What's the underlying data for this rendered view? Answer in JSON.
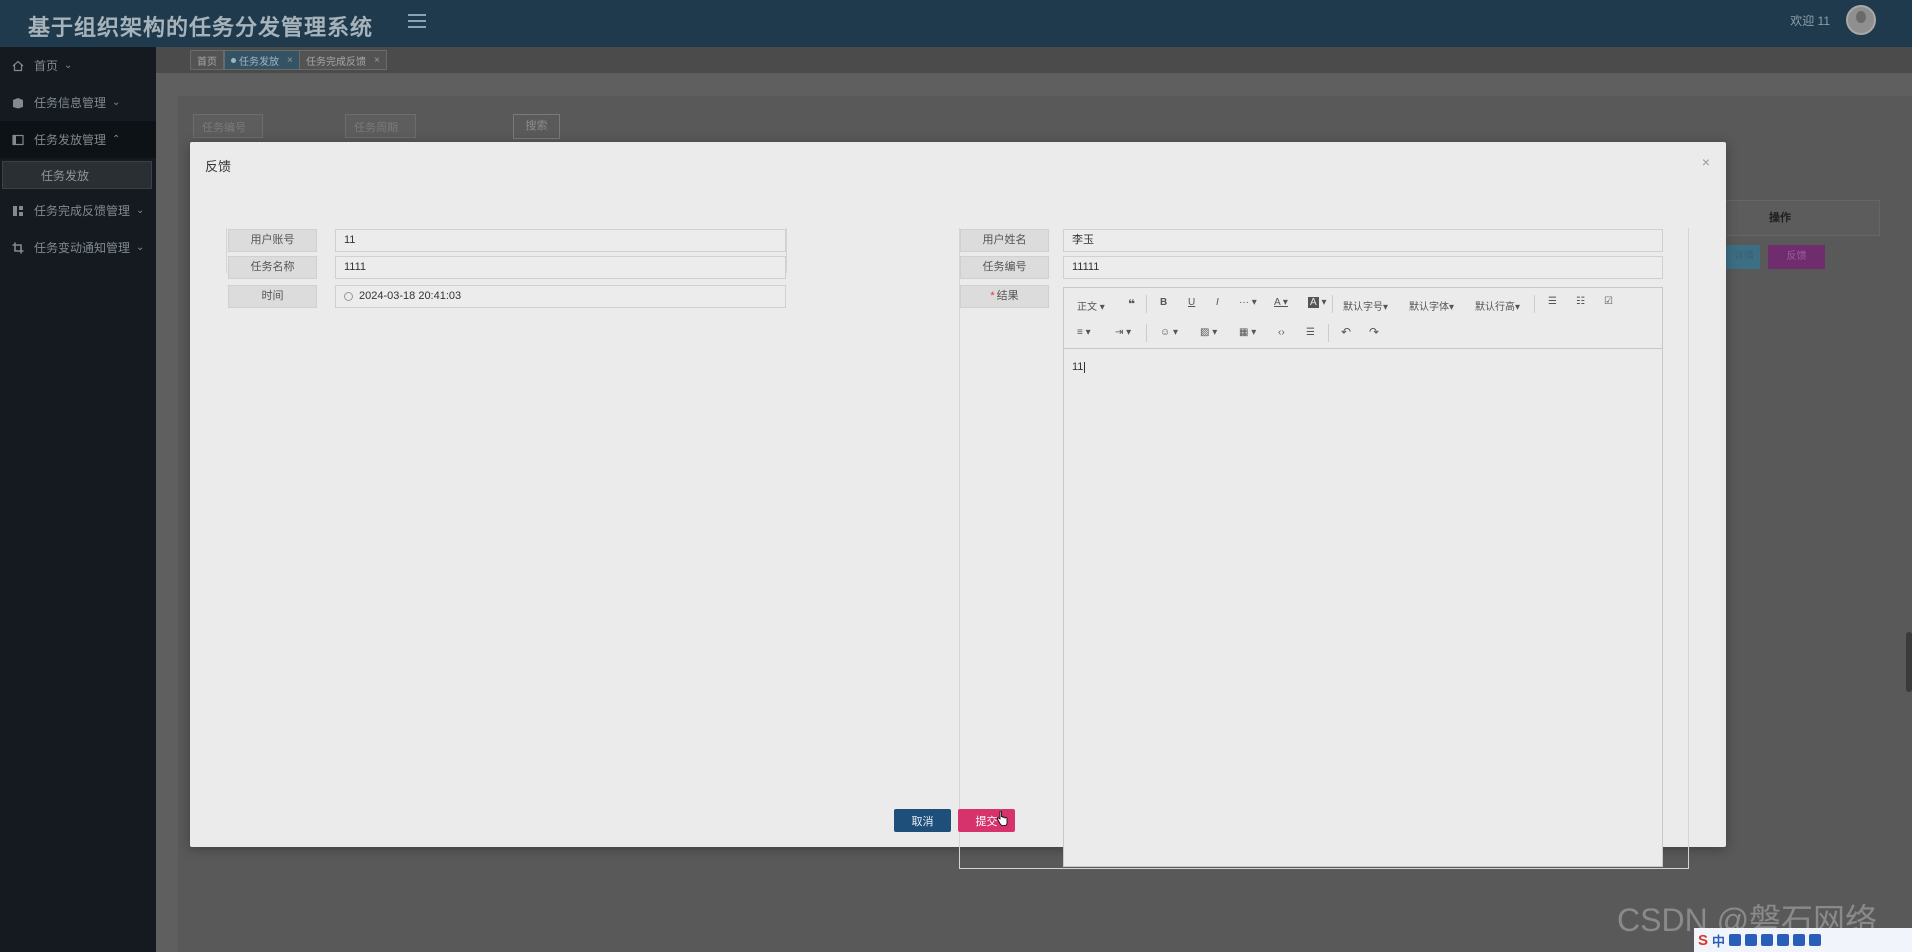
{
  "header": {
    "app_title": "基于组织架构的任务分发管理系统",
    "welcome": "欢迎 11"
  },
  "sidebar": {
    "items": [
      {
        "label": "首页",
        "icon": "home-icon"
      },
      {
        "label": "任务信息管理",
        "icon": "book-icon"
      },
      {
        "label": "任务发放管理",
        "icon": "panel-icon"
      },
      {
        "label": "任务完成反馈管理",
        "icon": "grid-icon"
      },
      {
        "label": "任务变动通知管理",
        "icon": "crop-icon"
      }
    ],
    "sub_item": "任务发放"
  },
  "tabs": [
    {
      "label": "首页"
    },
    {
      "label": "任务发放"
    },
    {
      "label": "任务完成反馈"
    }
  ],
  "background": {
    "task_no_placeholder": "任务编号",
    "task_cycle_placeholder": "任务周期",
    "search_label": "搜索",
    "ops_header": "操作",
    "detail_label": "详情",
    "feedback_label": "反馈"
  },
  "modal": {
    "title": "反馈",
    "close_glyph": "×",
    "fields": {
      "user_account_label": "用户账号",
      "user_account_value": "11",
      "user_name_label": "用户姓名",
      "user_name_value": "李玉",
      "task_name_label": "任务名称",
      "task_name_value": "1111",
      "task_no_label": "任务编号",
      "task_no_value": "11111",
      "time_label": "时间",
      "time_value": "2024-03-18 20:41:03",
      "result_label": "结果",
      "required_mark": "*"
    },
    "editor": {
      "toolbar": {
        "paragraph": "正文",
        "font_size": "默认字号",
        "font_family": "默认字体",
        "line_height": "默认行高",
        "bold": "B",
        "underline": "U",
        "italic": "I"
      },
      "content": "11"
    },
    "cancel_label": "取消",
    "submit_label": "提交"
  },
  "watermark": "CSDN @磐石网络",
  "ime": {
    "logo": "S",
    "mode": "中"
  }
}
